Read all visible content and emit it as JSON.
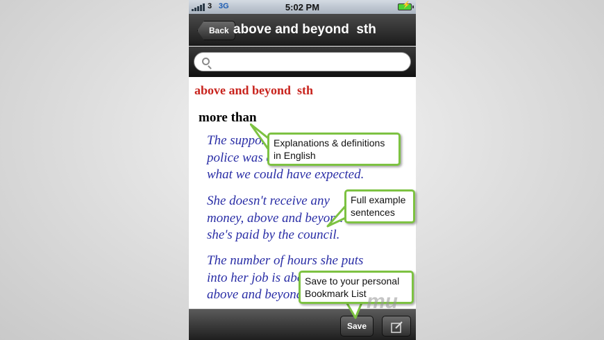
{
  "status_bar": {
    "carrier": "3",
    "network": "3G",
    "time": "5:02 PM"
  },
  "nav": {
    "back_label": "Back",
    "title": "above and beyond  sth"
  },
  "search": {
    "value": "",
    "placeholder": ""
  },
  "entry": {
    "headword": "above and beyond  sth",
    "definition": "more than",
    "examples": [
      [
        "The support of the",
        "police was above",
        "what we could have expected."
      ],
      [
        "She doesn't receive any",
        "money, above and beyond",
        "she's paid by the council."
      ],
      [
        "The number of hours she puts",
        "into her job is above",
        "above and beyond"
      ]
    ]
  },
  "toolbar": {
    "save_label": "Save",
    "edit_icon": "compose-icon"
  },
  "callouts": [
    [
      "Explanations & definitions",
      "in English"
    ],
    [
      "Full example",
      "sentences"
    ],
    [
      "Save to your personal",
      "Bookmark List"
    ]
  ],
  "watermark": "mu",
  "colors": {
    "headword": "#c8231d",
    "example_text": "#2a2ea6",
    "callout_border": "#7dc242"
  }
}
